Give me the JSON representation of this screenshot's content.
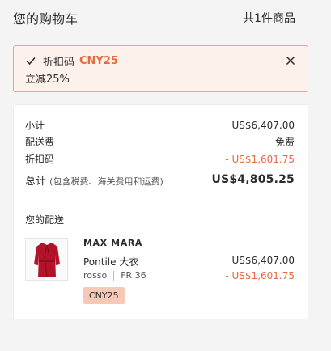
{
  "header": {
    "title": "您的购物车",
    "count": "共1件商品"
  },
  "promo": {
    "label": "折扣码",
    "code": "CNY25",
    "subtitle": "立减25%",
    "check_icon": "check-icon",
    "close_icon": "close-icon",
    "accent_color": "#e56a3f"
  },
  "summary": {
    "subtotal_label": "小计",
    "subtotal_value": "US$6,407.00",
    "shipping_label": "配送费",
    "shipping_value": "免费",
    "discount_label": "折扣码",
    "discount_value": "- US$1,601.75",
    "total_label": "总计",
    "total_note": "(包含税费、海关费用和运费)",
    "total_value": "US$4,805.25"
  },
  "shipment": {
    "title": "您的配送",
    "items": [
      {
        "brand": "MAX MARA",
        "name": "Pontile 大衣",
        "color": "rosso",
        "size": "FR 36",
        "price": "US$6,407.00",
        "discount": "- US$1,601.75",
        "promo_badge": "CNY25"
      }
    ]
  }
}
